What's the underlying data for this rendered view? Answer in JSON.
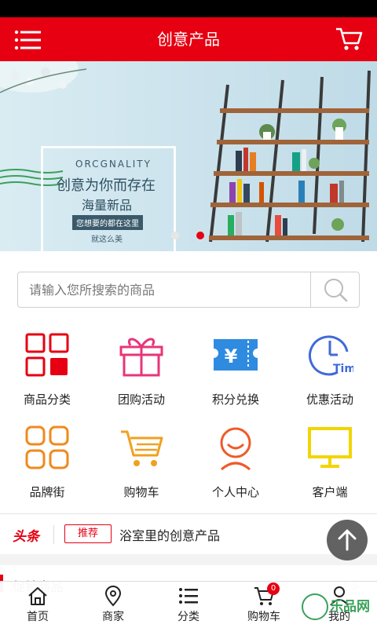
{
  "header": {
    "title": "创意产品"
  },
  "banner": {
    "brand": "ORCGNALITY",
    "slogan_line1": "创意为你而存在",
    "slogan_line2": "海量新品",
    "tag": "您想要的都在这里",
    "tag2": "就这么美"
  },
  "search": {
    "placeholder": "请输入您所搜索的商品"
  },
  "categories": [
    {
      "label": "商品分类",
      "icon": "grid-icon",
      "color": "#e60012"
    },
    {
      "label": "团购活动",
      "icon": "gift-icon",
      "color": "#e8357a"
    },
    {
      "label": "积分兑换",
      "icon": "ticket-yen-icon",
      "color": "#2e8be0"
    },
    {
      "label": "优惠活动",
      "icon": "clock-time-icon",
      "color": "#3f6ad8"
    },
    {
      "label": "品牌街",
      "icon": "brand-grid-icon",
      "color": "#f08a1c"
    },
    {
      "label": "购物车",
      "icon": "shopping-cart-icon",
      "color": "#f0a020"
    },
    {
      "label": "个人中心",
      "icon": "person-icon",
      "color": "#f05a28"
    },
    {
      "label": "客户端",
      "icon": "monitor-icon",
      "color": "#f2d500"
    }
  ],
  "news": {
    "head": "头条",
    "badge": "推荐",
    "text": "浴室里的创意产品"
  },
  "promo": {
    "title": "促销商品",
    "more": "更多"
  },
  "tabbar": {
    "items": [
      {
        "label": "首页",
        "icon": "home-icon"
      },
      {
        "label": "商家",
        "icon": "location-pin-icon"
      },
      {
        "label": "分类",
        "icon": "list-icon"
      },
      {
        "label": "购物车",
        "icon": "cart-icon",
        "badge": "0"
      },
      {
        "label": "我的",
        "icon": "user-icon"
      }
    ]
  },
  "watermark": {
    "text": "乐品网"
  }
}
